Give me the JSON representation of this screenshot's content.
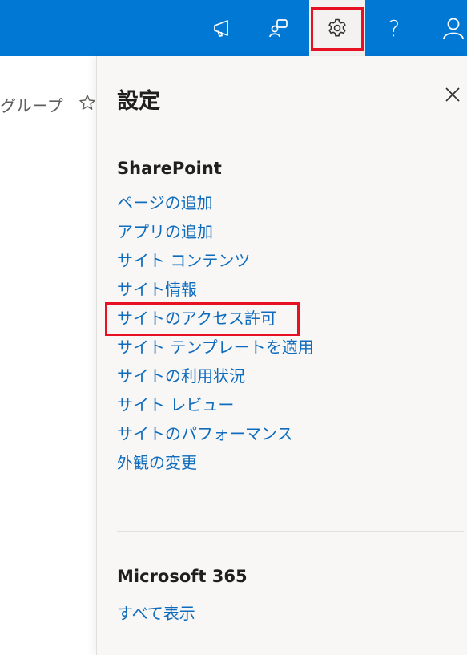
{
  "topbar": {
    "icons": [
      "megaphone-icon",
      "feedback-icon",
      "settings-gear-icon",
      "help-icon",
      "profile-icon"
    ],
    "help_label": "?",
    "accent_color": "#0078d4",
    "highlight_color": "#e81123"
  },
  "left": {
    "group_name_partial": "グループ",
    "star_glyph": "☆"
  },
  "panel": {
    "title": "設定",
    "sharepoint": {
      "title": "SharePoint",
      "links": [
        "ページの追加",
        "アプリの追加",
        "サイト コンテンツ",
        "サイト情報",
        "サイトのアクセス許可",
        "サイト テンプレートを適用",
        "サイトの利用状況",
        "サイト レビュー",
        "サイトのパフォーマンス",
        "外観の変更"
      ]
    },
    "microsoft365": {
      "title": "Microsoft 365",
      "show_all": "すべて表示"
    }
  }
}
